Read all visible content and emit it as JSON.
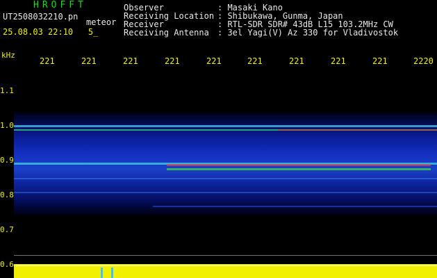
{
  "header": {
    "app_title": "HROFFT",
    "filename": "UT2508032210.pn",
    "meteor_label": "meteor",
    "timestamp": "25.08.03 22:10   5_"
  },
  "info": {
    "rows": [
      {
        "label": "Observer",
        "value": ": Masaki Kano"
      },
      {
        "label": "Receiving Location",
        "value": ": Shibukawa, Gunma, Japan"
      },
      {
        "label": "Receiver",
        "value": ": RTL-SDR SDR# 43dB L15 103.2MHz CW"
      },
      {
        "label": "Receiving Antenna",
        "value": ": 3el Yagi(V) Az 330 for Vladivostok"
      }
    ]
  },
  "axis": {
    "unit": "kHz",
    "x_ticks": [
      "221",
      "221",
      "221",
      "221",
      "221",
      "221",
      "221",
      "221",
      "221",
      "2220"
    ],
    "y_ticks": [
      "1.1",
      "1.0",
      "0.9",
      "0.8",
      "0.7",
      "0.6"
    ]
  },
  "colors": {
    "background": "#000000",
    "spectrum_bg": "#000060",
    "signal_cyan": "#40e0e0",
    "signal_red": "#ff3030",
    "strip_yellow": "#f0f000",
    "label_yellow": "#f0f000",
    "title_green": "#10e010"
  }
}
